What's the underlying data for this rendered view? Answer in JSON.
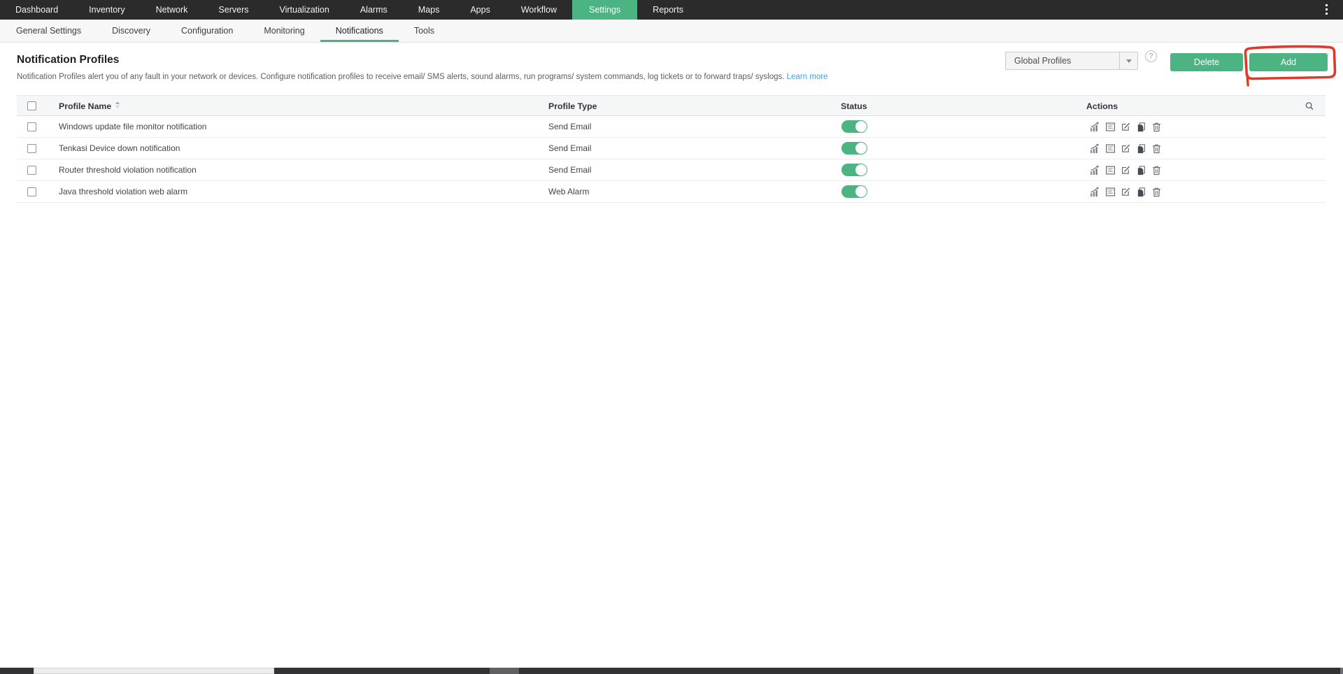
{
  "topnav": {
    "items": [
      {
        "label": "Dashboard",
        "active": false
      },
      {
        "label": "Inventory",
        "active": false
      },
      {
        "label": "Network",
        "active": false
      },
      {
        "label": "Servers",
        "active": false
      },
      {
        "label": "Virtualization",
        "active": false
      },
      {
        "label": "Alarms",
        "active": false
      },
      {
        "label": "Maps",
        "active": false
      },
      {
        "label": "Apps",
        "active": false
      },
      {
        "label": "Workflow",
        "active": false
      },
      {
        "label": "Settings",
        "active": true
      },
      {
        "label": "Reports",
        "active": false
      }
    ],
    "more_icon": "vertical-ellipsis"
  },
  "subnav": {
    "items": [
      {
        "label": "General Settings",
        "active": false
      },
      {
        "label": "Discovery",
        "active": false
      },
      {
        "label": "Configuration",
        "active": false
      },
      {
        "label": "Monitoring",
        "active": false
      },
      {
        "label": "Notifications",
        "active": true
      },
      {
        "label": "Tools",
        "active": false
      }
    ]
  },
  "page": {
    "title": "Notification Profiles",
    "description": "Notification Profiles alert you of any fault in your network or devices. Configure notification profiles to receive email/ SMS alerts, sound alarms, run programs/ system commands, log tickets or to forward traps/ syslogs.",
    "learn_more_label": "Learn more"
  },
  "controls": {
    "profile_scope_value": "Global Profiles",
    "help_label": "?",
    "delete_label": "Delete",
    "add_label": "Add",
    "annotation": "red rectangle drawn around Add button"
  },
  "table": {
    "columns": {
      "name": "Profile Name",
      "type": "Profile Type",
      "status": "Status",
      "actions": "Actions"
    },
    "action_icons": [
      "test-chart-icon",
      "report-icon",
      "edit-icon",
      "copy-icon",
      "trash-icon"
    ],
    "rows": [
      {
        "name": "Windows update file monitor notification",
        "type": "Send Email",
        "status_on": true
      },
      {
        "name": "Tenkasi Device down notification",
        "type": "Send Email",
        "status_on": true
      },
      {
        "name": "Router threshold violation notification",
        "type": "Send Email",
        "status_on": true
      },
      {
        "name": "Java threshold violation web alarm",
        "type": "Web Alarm",
        "status_on": true
      }
    ]
  },
  "colors": {
    "accent_green": "#4cb482",
    "topnav_bg": "#2b2b2b",
    "link_blue": "#42a0dd",
    "annotation_red": "#e2382a"
  }
}
